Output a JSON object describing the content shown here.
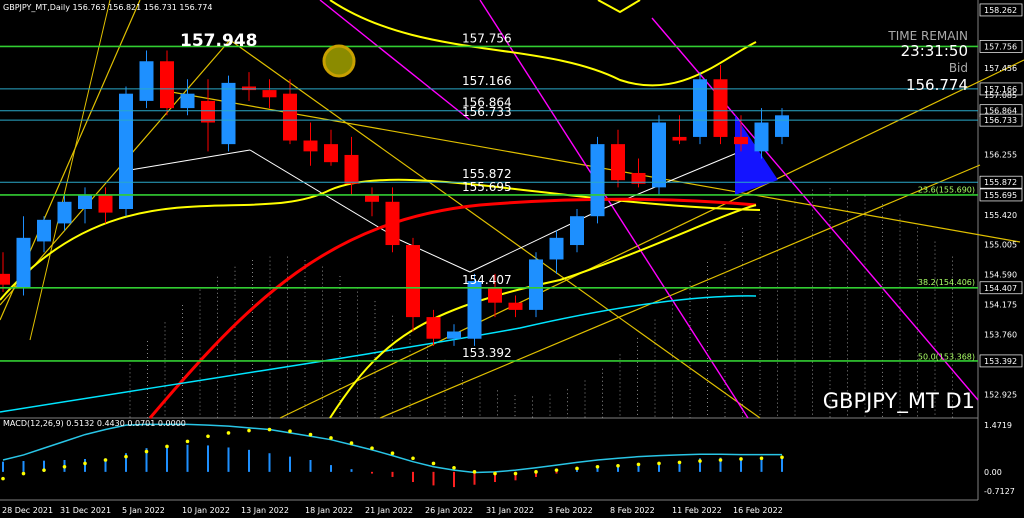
{
  "header_text": "GBPJPY_MT,Daily  156.763 156.821 156.731 156.774",
  "symbol_label": "GBPJPY_MT D1",
  "timer": {
    "title": "TIME REMAIN",
    "value": "23:31:50",
    "bid_label": "Bid",
    "bid_value": "156.774"
  },
  "colors": {
    "bull": "#1e90ff",
    "bear": "#ff0000",
    "level": "#32cd32",
    "axis": "#c0c0c0",
    "macd_line": "#29c5e6",
    "signal": "#ffff00"
  },
  "price_axis": {
    "min": 152.6,
    "max": 158.4,
    "ticks": [
      "158.262",
      "157.756",
      "157.456",
      "157.166",
      "157.085",
      "156.864",
      "156.733",
      "156.255",
      "155.872",
      "155.695",
      "155.420",
      "155.005",
      "154.590",
      "154.407",
      "154.175",
      "153.760",
      "153.392",
      "152.925"
    ]
  },
  "level_labels": [
    {
      "price": 157.756,
      "text": "157.756"
    },
    {
      "price": 157.166,
      "text": "157.166"
    },
    {
      "price": 156.864,
      "text": "156.864"
    },
    {
      "price": 156.733,
      "text": "156.733"
    },
    {
      "price": 155.872,
      "text": "155.872"
    },
    {
      "price": 155.695,
      "text": "155.695"
    },
    {
      "price": 154.407,
      "text": "154.407"
    },
    {
      "price": 153.392,
      "text": "153.392"
    }
  ],
  "high_label": {
    "text": "157.948",
    "price": 157.948
  },
  "fib_labels": [
    "23.6(155.690)",
    "38.2(154.406)",
    "50.0(153.368)"
  ],
  "macd": {
    "label": "MACD(12,26,9) 0.5132 0.4430 0.0701 0.0000",
    "ticks": [
      "1.4719",
      "0.00",
      "-0.7127"
    ],
    "range": [
      -0.7127,
      1.4719
    ]
  },
  "date_labels": [
    "28 Dec 2021",
    "31 Dec 2021",
    "5 Jan 2022",
    "10 Jan 2022",
    "13 Jan 2022",
    "18 Jan 2022",
    "21 Jan 2022",
    "26 Jan 2022",
    "31 Jan 2022",
    "3 Feb 2022",
    "8 Feb 2022",
    "11 Feb 2022",
    "16 Feb 2022"
  ],
  "chart_data": {
    "type": "candlestick",
    "candles": [
      {
        "o": 154.6,
        "h": 154.9,
        "l": 154.35,
        "c": 154.45
      },
      {
        "o": 154.4,
        "h": 155.4,
        "l": 154.3,
        "c": 155.1
      },
      {
        "o": 155.05,
        "h": 155.4,
        "l": 154.9,
        "c": 155.35
      },
      {
        "o": 155.3,
        "h": 155.7,
        "l": 155.2,
        "c": 155.6
      },
      {
        "o": 155.5,
        "h": 155.8,
        "l": 155.3,
        "c": 155.7
      },
      {
        "o": 155.7,
        "h": 155.8,
        "l": 155.3,
        "c": 155.45
      },
      {
        "o": 155.5,
        "h": 157.2,
        "l": 155.4,
        "c": 157.1
      },
      {
        "o": 157.0,
        "h": 157.7,
        "l": 156.9,
        "c": 157.55
      },
      {
        "o": 157.55,
        "h": 157.7,
        "l": 156.8,
        "c": 156.9
      },
      {
        "o": 156.9,
        "h": 157.3,
        "l": 156.8,
        "c": 157.1
      },
      {
        "o": 157.0,
        "h": 157.3,
        "l": 156.3,
        "c": 156.7
      },
      {
        "o": 156.4,
        "h": 157.35,
        "l": 156.3,
        "c": 157.25
      },
      {
        "o": 157.2,
        "h": 157.4,
        "l": 157.0,
        "c": 157.15
      },
      {
        "o": 157.15,
        "h": 157.3,
        "l": 156.9,
        "c": 157.05
      },
      {
        "o": 157.1,
        "h": 157.3,
        "l": 156.4,
        "c": 156.45
      },
      {
        "o": 156.45,
        "h": 156.7,
        "l": 156.1,
        "c": 156.3
      },
      {
        "o": 156.4,
        "h": 156.6,
        "l": 156.1,
        "c": 156.15
      },
      {
        "o": 156.25,
        "h": 156.5,
        "l": 155.7,
        "c": 155.85
      },
      {
        "o": 155.7,
        "h": 155.8,
        "l": 155.4,
        "c": 155.6
      },
      {
        "o": 155.6,
        "h": 155.8,
        "l": 154.9,
        "c": 155.0
      },
      {
        "o": 155.0,
        "h": 155.1,
        "l": 153.8,
        "c": 154.0
      },
      {
        "o": 154.0,
        "h": 154.1,
        "l": 153.6,
        "c": 153.7
      },
      {
        "o": 153.7,
        "h": 153.9,
        "l": 153.6,
        "c": 153.8
      },
      {
        "o": 153.7,
        "h": 154.6,
        "l": 153.6,
        "c": 154.5
      },
      {
        "o": 154.4,
        "h": 154.6,
        "l": 154.0,
        "c": 154.2
      },
      {
        "o": 154.2,
        "h": 154.3,
        "l": 154.0,
        "c": 154.1
      },
      {
        "o": 154.1,
        "h": 154.9,
        "l": 154.0,
        "c": 154.8
      },
      {
        "o": 154.8,
        "h": 155.2,
        "l": 154.6,
        "c": 155.1
      },
      {
        "o": 155.0,
        "h": 155.5,
        "l": 154.9,
        "c": 155.4
      },
      {
        "o": 155.4,
        "h": 156.5,
        "l": 155.3,
        "c": 156.4
      },
      {
        "o": 156.4,
        "h": 156.6,
        "l": 155.8,
        "c": 155.9
      },
      {
        "o": 156.0,
        "h": 156.2,
        "l": 155.8,
        "c": 155.85
      },
      {
        "o": 155.8,
        "h": 156.8,
        "l": 155.7,
        "c": 156.7
      },
      {
        "o": 156.5,
        "h": 156.8,
        "l": 156.4,
        "c": 156.45
      },
      {
        "o": 156.5,
        "h": 157.4,
        "l": 156.4,
        "c": 157.3
      },
      {
        "o": 157.3,
        "h": 157.5,
        "l": 156.4,
        "c": 156.5
      },
      {
        "o": 156.5,
        "h": 156.8,
        "l": 156.3,
        "c": 156.4
      },
      {
        "o": 156.3,
        "h": 156.9,
        "l": 156.2,
        "c": 156.7
      },
      {
        "o": 156.5,
        "h": 156.9,
        "l": 156.4,
        "c": 156.8
      }
    ],
    "macd_hist": [
      0.3,
      0.32,
      0.33,
      0.35,
      0.38,
      0.4,
      0.55,
      0.7,
      0.78,
      0.8,
      0.78,
      0.72,
      0.65,
      0.55,
      0.45,
      0.35,
      0.2,
      0.08,
      -0.05,
      -0.15,
      -0.3,
      -0.4,
      -0.45,
      -0.38,
      -0.3,
      -0.25,
      -0.15,
      -0.05,
      0.05,
      0.15,
      0.2,
      0.22,
      0.28,
      0.3,
      0.4,
      0.42,
      0.4,
      0.42,
      0.45
    ],
    "macd_signal": [
      -0.2,
      -0.05,
      0.05,
      0.15,
      0.25,
      0.35,
      0.45,
      0.6,
      0.75,
      0.9,
      1.05,
      1.15,
      1.22,
      1.25,
      1.2,
      1.1,
      1.0,
      0.85,
      0.7,
      0.55,
      0.4,
      0.25,
      0.12,
      0.0,
      -0.05,
      -0.05,
      0.0,
      0.05,
      0.1,
      0.15,
      0.18,
      0.22,
      0.25,
      0.28,
      0.32,
      0.35,
      0.38,
      0.4,
      0.43
    ],
    "macd_line": [
      0.35,
      0.5,
      0.7,
      0.9,
      1.1,
      1.25,
      1.38,
      1.4,
      1.4,
      1.4,
      1.38,
      1.35,
      1.3,
      1.25,
      1.15,
      1.05,
      0.95,
      0.8,
      0.65,
      0.48,
      0.3,
      0.15,
      0.05,
      -0.02,
      0.0,
      0.05,
      0.12,
      0.2,
      0.28,
      0.35,
      0.4,
      0.45,
      0.48,
      0.5,
      0.52,
      0.52,
      0.51,
      0.51,
      0.51
    ]
  }
}
